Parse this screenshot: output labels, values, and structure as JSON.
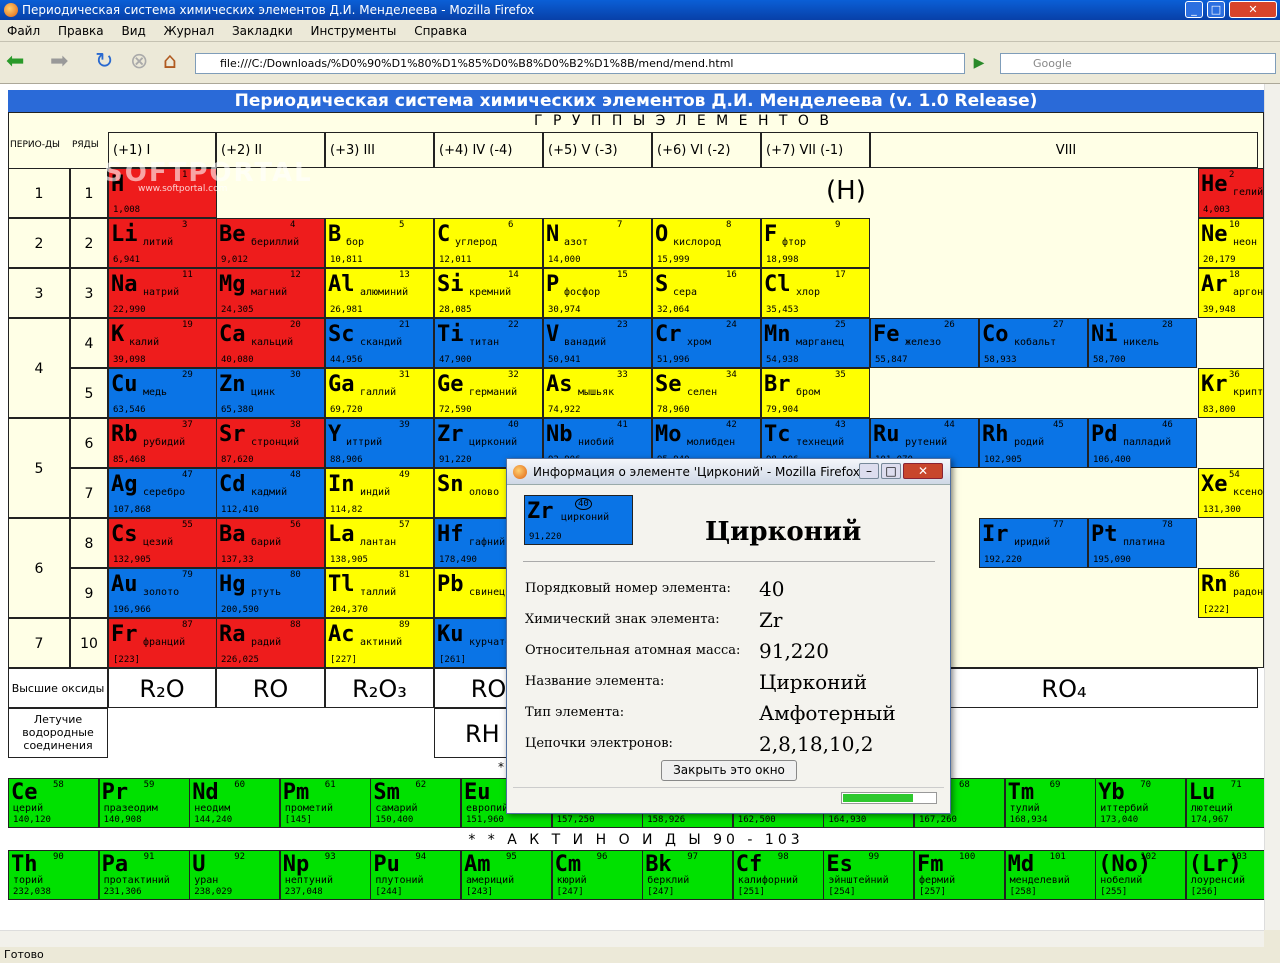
{
  "window": {
    "title": "Периодическая система химических элементов Д.И. Менделеева - Mozilla Firefox"
  },
  "menu": [
    "Файл",
    "Правка",
    "Вид",
    "Журнал",
    "Закладки",
    "Инструменты",
    "Справка"
  ],
  "nav": {
    "url": "file:///C:/Downloads/%D0%90%D1%80%D1%85%D0%B8%D0%B2%D1%8B/mend/mend.html",
    "search_placeholder": "Google"
  },
  "status": "Готово",
  "table": {
    "title": "Периодическая система химических элементов Д.И. Менделеева (v. 1.0 Release)",
    "groups_header": "Г  Р  У  П  П  Ы      Э  Л  Е  М  Е  Н  Т  О  В",
    "col_periods": "ПЕРИО-ДЫ",
    "col_rows": "РЯДЫ",
    "group_labels": [
      "(+1)   I",
      "(+2)   II",
      "(+3)   III",
      "(+4)    IV  (-4)",
      "(+5)    V      (-3)",
      "(+6)   VI      (-2)",
      "(+7)   VII     (-1)",
      "VIII"
    ],
    "h_note": "(H)",
    "periods": [
      "1",
      "2",
      "3",
      "4",
      "5",
      "6",
      "7"
    ],
    "rows": [
      "1",
      "2",
      "3",
      "4",
      "5",
      "6",
      "7",
      "8",
      "9",
      "10"
    ],
    "oxides_label": "Высшие оксиды",
    "oxides": [
      "R₂O",
      "RO",
      "R₂O₃",
      "RO",
      "",
      "",
      "",
      "RO₄"
    ],
    "volatile_label": "Летучие водородные соединения",
    "volatile": [
      "RH"
    ],
    "lanth_label": "*",
    "actin_label": "* *  А К Т И Н О И Д Ы  90 - 103",
    "watermark": "SOFTPORTAL",
    "watermark_url": "www.softportal.com"
  },
  "dialog": {
    "title": "Информация о элементе 'Цирконий' - Mozilla Firefox",
    "symbol": "Zr",
    "number": "40",
    "name_small": "цирконий",
    "mass": "91,220",
    "heading": "Цирконий",
    "fields": [
      {
        "label": "Порядковый номер элемента:",
        "value": "40"
      },
      {
        "label": "Химический знак элемента:",
        "value": "Zr"
      },
      {
        "label": "Относительная атомная масса:",
        "value": "91,220"
      },
      {
        "label": "Название элемента:",
        "value": "Цирконий"
      },
      {
        "label": "Тип элемента:",
        "value": "Амфотерный"
      },
      {
        "label": "Цепочки электронов:",
        "value": "2,8,18,10,2"
      }
    ],
    "close_button": "Закрыть это окно"
  }
}
